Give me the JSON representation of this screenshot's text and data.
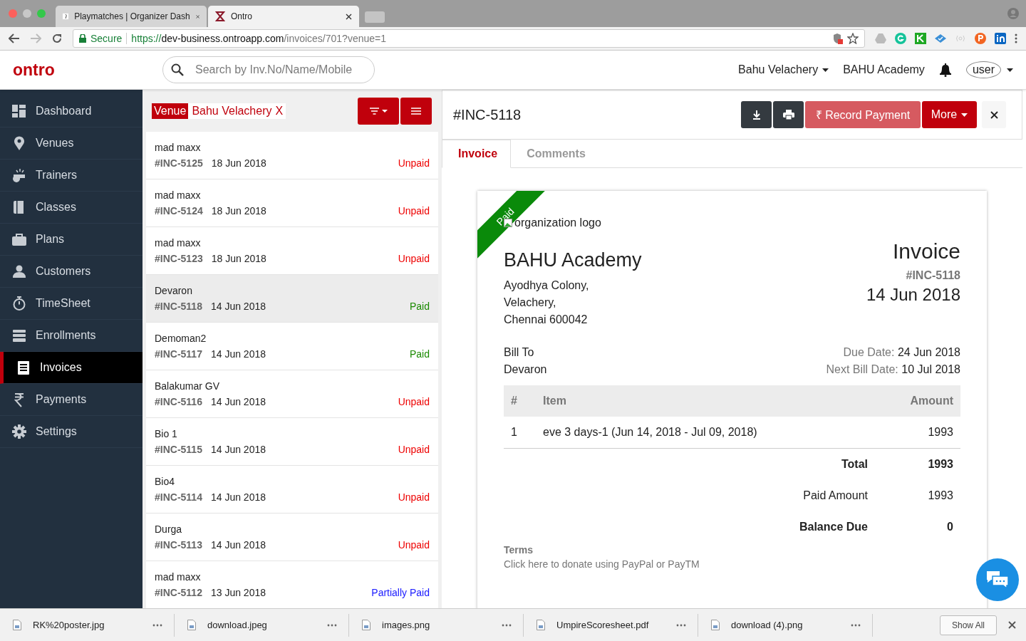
{
  "browser": {
    "tabs": [
      {
        "title": "Playmatches | Organizer Dash",
        "selected": false
      },
      {
        "title": "Ontro",
        "selected": true
      }
    ],
    "secure_label": "Secure",
    "url_scheme": "https://",
    "url_host": "dev-business.ontroapp.com",
    "url_path": "/invoices/701?venue=1"
  },
  "header": {
    "logo": "ontro",
    "search": {
      "placeholder": "Search by Inv.No/Name/Mobile"
    },
    "venue_menu": "Bahu Velachery",
    "organization": "BAHU Academy",
    "avatar_alt": "user"
  },
  "sidebar": {
    "items": [
      {
        "label": "Dashboard",
        "kind": "dashboard",
        "selected": false
      },
      {
        "label": "Venues",
        "kind": "pin",
        "selected": false
      },
      {
        "label": "Trainers",
        "kind": "whistle",
        "selected": false
      },
      {
        "label": "Classes",
        "kind": "book",
        "selected": false
      },
      {
        "label": "Plans",
        "kind": "briefcase",
        "selected": false
      },
      {
        "label": "Customers",
        "kind": "person",
        "selected": false
      },
      {
        "label": "TimeSheet",
        "kind": "stopwatch",
        "selected": false
      },
      {
        "label": "Enrollments",
        "kind": "stack",
        "selected": false
      },
      {
        "label": "Invoices",
        "kind": "list",
        "selected": true
      },
      {
        "label": "Payments",
        "kind": "rupee",
        "selected": false
      },
      {
        "label": "Settings",
        "kind": "gear",
        "selected": false
      }
    ]
  },
  "invoice_list": {
    "filter": {
      "label": "Venue",
      "value": "Bahu Velachery",
      "remove": "X"
    },
    "rows": [
      {
        "name": "mad maxx",
        "number": "#INC-5125",
        "date": "18 Jun 2018",
        "status": "Unpaid",
        "kind": "unpaid",
        "selected": false
      },
      {
        "name": "mad maxx",
        "number": "#INC-5124",
        "date": "18 Jun 2018",
        "status": "Unpaid",
        "kind": "unpaid",
        "selected": false
      },
      {
        "name": "mad maxx",
        "number": "#INC-5123",
        "date": "18 Jun 2018",
        "status": "Unpaid",
        "kind": "unpaid",
        "selected": false
      },
      {
        "name": "Devaron",
        "number": "#INC-5118",
        "date": "14 Jun 2018",
        "status": "Paid",
        "kind": "paid",
        "selected": true
      },
      {
        "name": "Demoman2",
        "number": "#INC-5117",
        "date": "14 Jun 2018",
        "status": "Paid",
        "kind": "paid",
        "selected": false
      },
      {
        "name": "Balakumar GV",
        "number": "#INC-5116",
        "date": "14 Jun 2018",
        "status": "Unpaid",
        "kind": "unpaid",
        "selected": false
      },
      {
        "name": "Bio 1",
        "number": "#INC-5115",
        "date": "14 Jun 2018",
        "status": "Unpaid",
        "kind": "unpaid",
        "selected": false
      },
      {
        "name": "Bio4",
        "number": "#INC-5114",
        "date": "14 Jun 2018",
        "status": "Unpaid",
        "kind": "unpaid",
        "selected": false
      },
      {
        "name": "Durga",
        "number": "#INC-5113",
        "date": "14 Jun 2018",
        "status": "Unpaid",
        "kind": "unpaid",
        "selected": false
      },
      {
        "name": "mad maxx",
        "number": "#INC-5112",
        "date": "13 Jun 2018",
        "status": "Partially Paid",
        "kind": "partial",
        "selected": false
      }
    ]
  },
  "detail": {
    "title": "#INC-5118",
    "record_payment": "₹ Record Payment",
    "more": "More",
    "tabs": [
      {
        "label": "Invoice",
        "selected": true
      },
      {
        "label": "Comments",
        "selected": false
      }
    ],
    "invoice": {
      "ribbon": "Paid",
      "logo_alt": "organization logo",
      "org_name": "BAHU Academy",
      "address": [
        "Ayodhya Colony,",
        "Velachery,",
        "Chennai 600042"
      ],
      "heading": "Invoice",
      "number": "#INC-5118",
      "date": "14 Jun 2018",
      "bill_to_label": "Bill To",
      "bill_to": "Devaron",
      "due_label": "Due Date:",
      "due_date": "24 Jun 2018",
      "next_label": "Next Bill Date:",
      "next_date": "10 Jul 2018",
      "columns": [
        "#",
        "Item",
        "Amount"
      ],
      "items": [
        {
          "index": "1",
          "item": "eve 3 days-1 (Jun 14, 2018 - Jul 09, 2018)",
          "amount": "1993"
        }
      ],
      "totals": [
        {
          "label": "Total",
          "value": "1993",
          "bold": true
        },
        {
          "label": "Paid Amount",
          "value": "1993",
          "bold": false
        },
        {
          "label": "Balance Due",
          "value": "0",
          "bold": true
        }
      ],
      "terms_label": "Terms",
      "terms_link": "Click here to donate using PayPal or PayTM"
    }
  },
  "downloads": {
    "files": [
      "RK%20poster.jpg",
      "download.jpeg",
      "images.png",
      "UmpireScoresheet.pdf",
      "download (4).png"
    ],
    "show_all": "Show All"
  }
}
